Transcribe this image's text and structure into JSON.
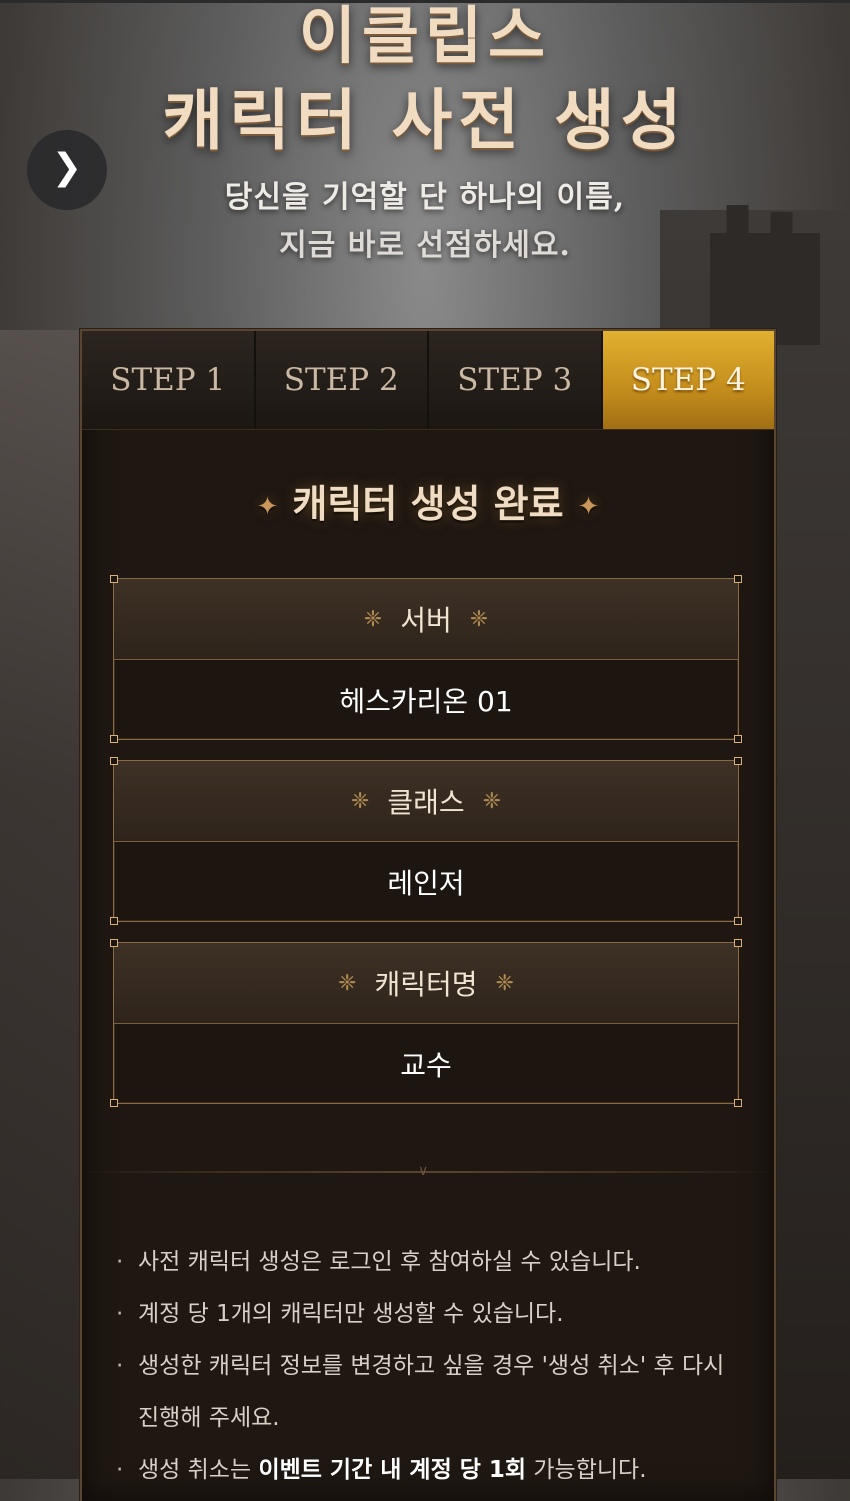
{
  "hero": {
    "title_line1": "이클립스",
    "title_line2": "캐릭터 사전 생성",
    "subtitle_line1": "당신을 기억할 단 하나의 이름,",
    "subtitle_line2": "지금 바로 선점하세요."
  },
  "nav": {
    "next_icon": "chevron-right-icon"
  },
  "steps": [
    {
      "label": "STEP 1",
      "active": false
    },
    {
      "label": "STEP 2",
      "active": false
    },
    {
      "label": "STEP 3",
      "active": false
    },
    {
      "label": "STEP 4",
      "active": true
    }
  ],
  "result": {
    "title": "캐릭터 생성 완료",
    "server": {
      "label": "서버",
      "value": "헤스카리온 01"
    },
    "class": {
      "label": "클래스",
      "value": "레인저"
    },
    "character_name": {
      "label": "캐릭터명",
      "value": "교수"
    }
  },
  "notes": {
    "item1": "사전 캐릭터 생성은 로그인 후 참여하실 수 있습니다.",
    "item2": "계정 당 1개의 캐릭터만 생성할 수 있습니다.",
    "item3_line1": "생성한 캐릭터 정보를 변경하고 싶을 경우 '생성 취소' 후 다시",
    "item3_line2": "진행해 주세요.",
    "item4_prefix": "생성 취소는 ",
    "item4_bold": "이벤트 기간 내 계정 당 1회",
    "item4_suffix": " 가능합니다."
  },
  "colors": {
    "accent_gold": "#d9a52a",
    "panel_bg": "#1e1712",
    "title_text": "#f1dcc1"
  }
}
